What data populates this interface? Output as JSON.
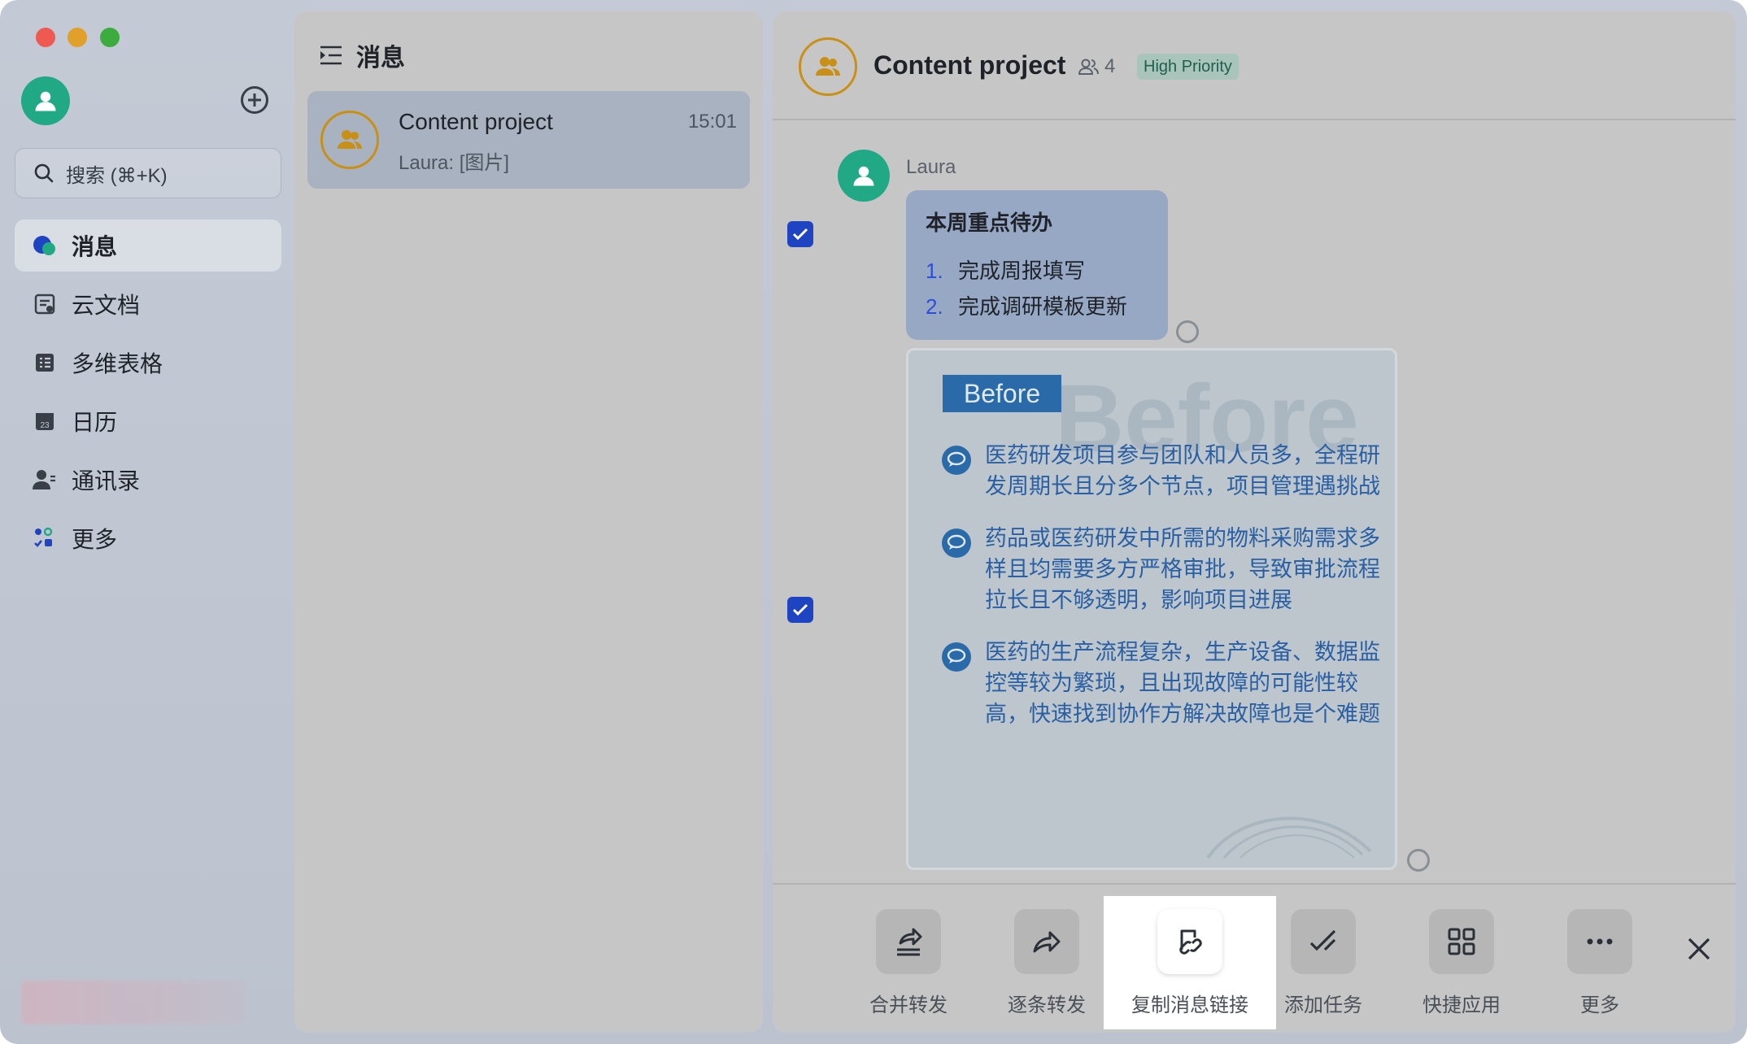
{
  "sidebar": {
    "search_placeholder": "搜索 (⌘+K)",
    "items": [
      {
        "label": "消息",
        "icon": "message-icon",
        "active": true
      },
      {
        "label": "云文档",
        "icon": "docs-icon"
      },
      {
        "label": "多维表格",
        "icon": "base-table-icon"
      },
      {
        "label": "日历",
        "icon": "calendar-icon",
        "badge": "23"
      },
      {
        "label": "通讯录",
        "icon": "contacts-icon"
      },
      {
        "label": "更多",
        "icon": "apps-grid-icon"
      }
    ]
  },
  "list": {
    "title": "消息",
    "conversations": [
      {
        "name": "Content project",
        "time": "15:01",
        "preview": "Laura: [图片]"
      }
    ]
  },
  "chat": {
    "title": "Content project",
    "member_count": "4",
    "priority_tag": "High Priority",
    "sender": "Laura",
    "todo": {
      "title": "本周重点待办",
      "items": [
        {
          "num": "1.",
          "text": "完成周报填写"
        },
        {
          "num": "2.",
          "text": "完成调研模板更新"
        }
      ]
    },
    "image_card": {
      "badge": "Before",
      "watermark": "Before",
      "points": [
        "医药研发项目参与团队和人员多，全程研发周期长且分多个节点，项目管理遇挑战",
        "药品或医药研发中所需的物料采购需求多样且均需要多方严格审批，导致审批流程拉长且不够透明，影响项目进展",
        "医药的生产流程复杂，生产设备、数据监控等较为繁琐，且出现故障的可能性较高，快速找到协作方解决故障也是个难题"
      ]
    }
  },
  "actions": [
    {
      "label": "合并转发",
      "icon": "merge-forward-icon"
    },
    {
      "label": "逐条转发",
      "icon": "forward-icon"
    },
    {
      "label": "复制消息链接",
      "icon": "copy-link-icon",
      "highlight": true
    },
    {
      "label": "添加任务",
      "icon": "add-task-icon"
    },
    {
      "label": "快捷应用",
      "icon": "quick-apps-icon"
    },
    {
      "label": "更多",
      "icon": "more-icon"
    }
  ],
  "colors": {
    "accent_blue": "#1f44c2",
    "avatar_green": "#21a885",
    "group_ring": "#c89016",
    "priority_bg": "#a8c4bb"
  }
}
